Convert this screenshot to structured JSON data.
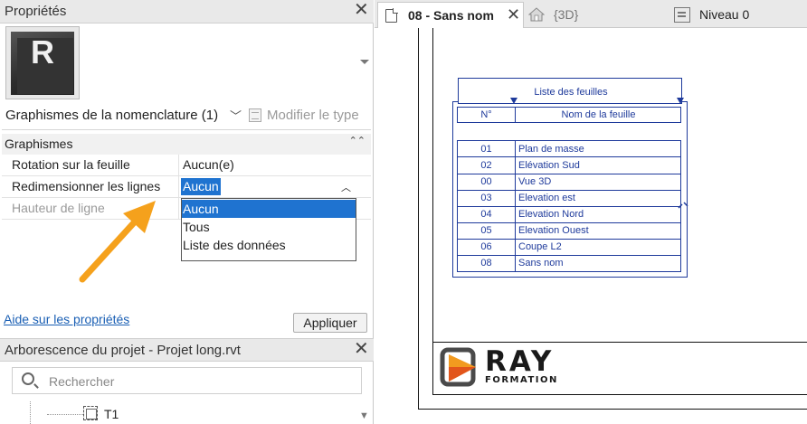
{
  "properties": {
    "title": "Propriétés",
    "type_selector": "Graphismes de la nomenclature (1)",
    "edit_type_label": "Modifier le type",
    "group": "Graphismes",
    "rows": [
      {
        "name": "Rotation sur la feuille",
        "value": "Aucun(e)"
      },
      {
        "name": "Redimensionner les lignes",
        "value": "Aucun"
      },
      {
        "name": "Hauteur de ligne",
        "value": ""
      }
    ],
    "dropdown_options": [
      "Aucun",
      "Tous",
      "Liste des données"
    ],
    "dropdown_selected": "Aucun",
    "help_link": "Aide sur les propriétés",
    "apply_label": "Appliquer"
  },
  "project_browser": {
    "title": "Arborescence du projet - Projet long.rvt",
    "search_placeholder": "Rechercher",
    "tree_item": "T1"
  },
  "tabs": [
    {
      "label": "08 - Sans nom",
      "active": true
    },
    {
      "label": "{3D}",
      "active": false
    },
    {
      "label": "Niveau 0",
      "active": false
    }
  ],
  "schedule": {
    "title": "Liste des feuilles",
    "col_num": "N°",
    "col_name": "Nom de la feuille",
    "rows": [
      {
        "num": "01",
        "name": "Plan de masse"
      },
      {
        "num": "02",
        "name": "Elévation Sud"
      },
      {
        "num": "00",
        "name": "Vue 3D"
      },
      {
        "num": "03",
        "name": "Elevation est"
      },
      {
        "num": "04",
        "name": "Elevation Nord"
      },
      {
        "num": "05",
        "name": "Elevation Ouest"
      },
      {
        "num": "06",
        "name": "Coupe L2"
      },
      {
        "num": "08",
        "name": "Sans nom"
      }
    ]
  },
  "logo": {
    "main": "RAY",
    "sub": "FORMATION"
  },
  "colors": {
    "accent": "#1f73d0",
    "schedule_blue": "#1e3a9b",
    "arrow_orange": "#f5a11c"
  }
}
